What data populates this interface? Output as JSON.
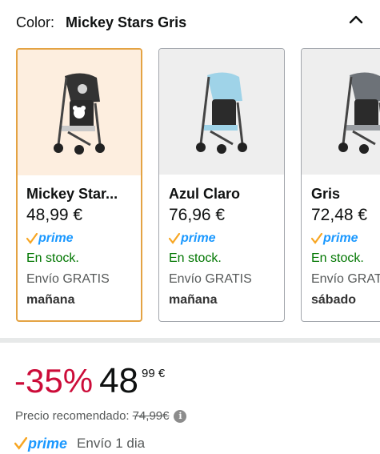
{
  "header": {
    "color_label": "Color:",
    "color_value": "Mickey Stars Gris",
    "collapse_icon": "chevron-up-icon"
  },
  "variants": [
    {
      "name": "Mickey Star...",
      "price": "48,99 €",
      "prime": "prime",
      "stock": "En stock.",
      "shipping": "Envío GRATIS",
      "day": "mañana",
      "selected": true,
      "canopy_color": "#3a3a3a"
    },
    {
      "name": "Azul Claro",
      "price": "76,96 €",
      "prime": "prime",
      "stock": "En stock.",
      "shipping": "Envío GRATIS",
      "day": "mañana",
      "selected": false,
      "canopy_color": "#9fd3e8"
    },
    {
      "name": "Gris",
      "price": "72,48 €",
      "prime": "prime",
      "stock": "En stock.",
      "shipping": "Envío GRATIS",
      "day": "sábado",
      "selected": false,
      "canopy_color": "#6d7278"
    }
  ],
  "pricing": {
    "discount": "-35%",
    "price_whole": "48",
    "price_fraction": "99 €",
    "rrp_label": "Precio recomendado:",
    "rrp_value": "74,99€",
    "info_icon": "info-icon"
  },
  "delivery": {
    "prime": "prime",
    "text": "Envío 1 dia"
  },
  "colors": {
    "selected_border": "#e4a343",
    "selected_bg": "#fdeedf",
    "discount": "#cc0c39",
    "prime": "#1a98ff",
    "stock": "#007600"
  }
}
